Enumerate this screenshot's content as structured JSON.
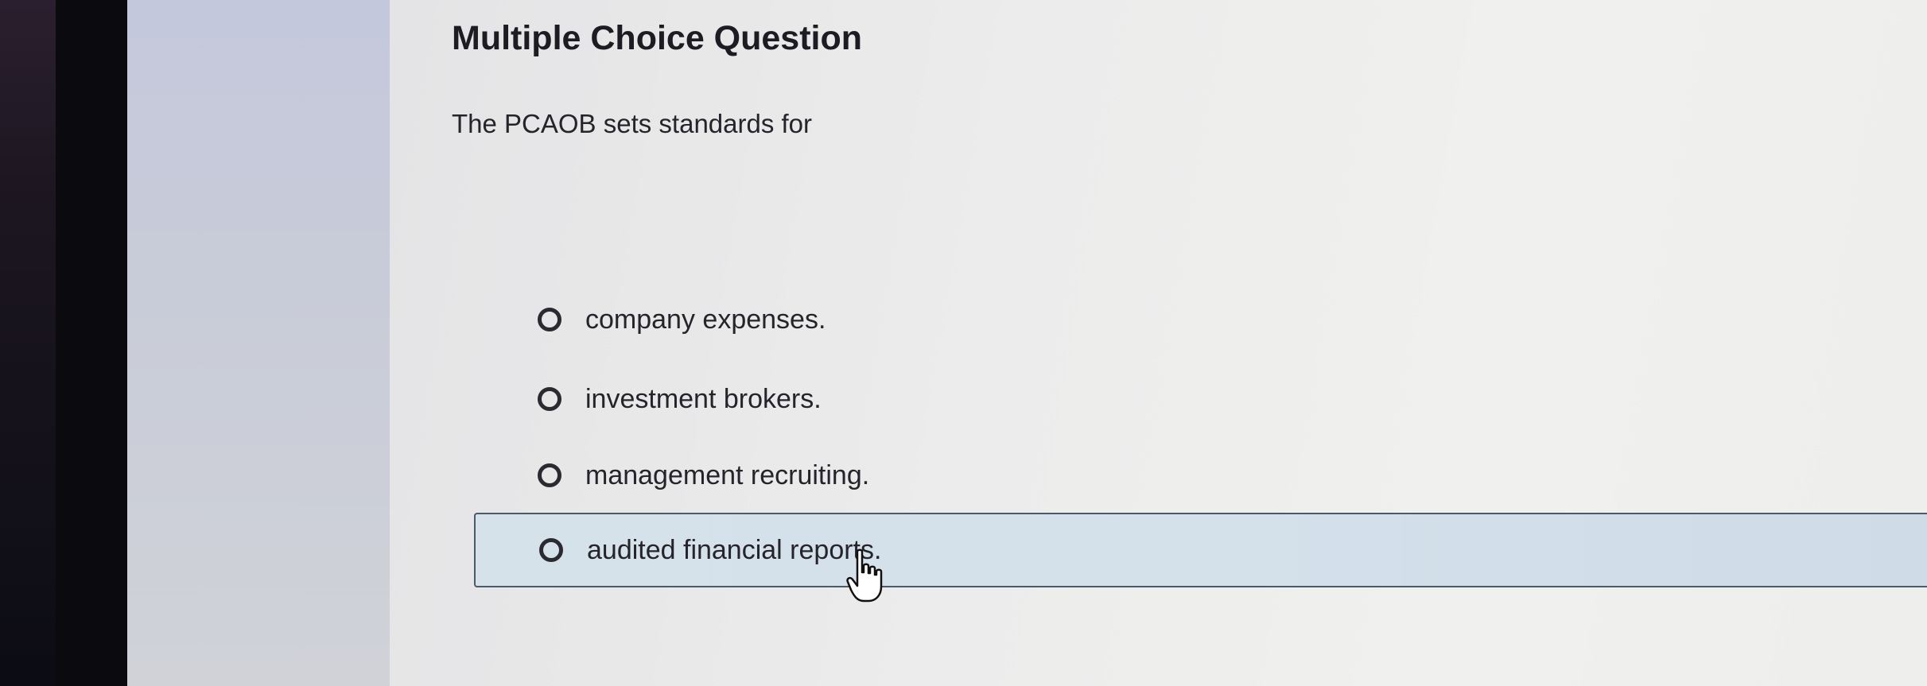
{
  "question": {
    "title": "Multiple Choice Question",
    "stem": "The PCAOB sets standards for"
  },
  "options": [
    {
      "label": "company expenses.",
      "highlighted": false
    },
    {
      "label": "investment brokers.",
      "highlighted": false
    },
    {
      "label": "management recruiting.",
      "highlighted": false
    },
    {
      "label": "audited financial reports.",
      "highlighted": true
    }
  ],
  "colors": {
    "highlight_bg": "#d4e0ea",
    "highlight_border": "#4a5a68",
    "text": "#24242a"
  },
  "icons": {
    "radio": "radio-button-icon",
    "cursor": "hand-pointer-icon"
  }
}
